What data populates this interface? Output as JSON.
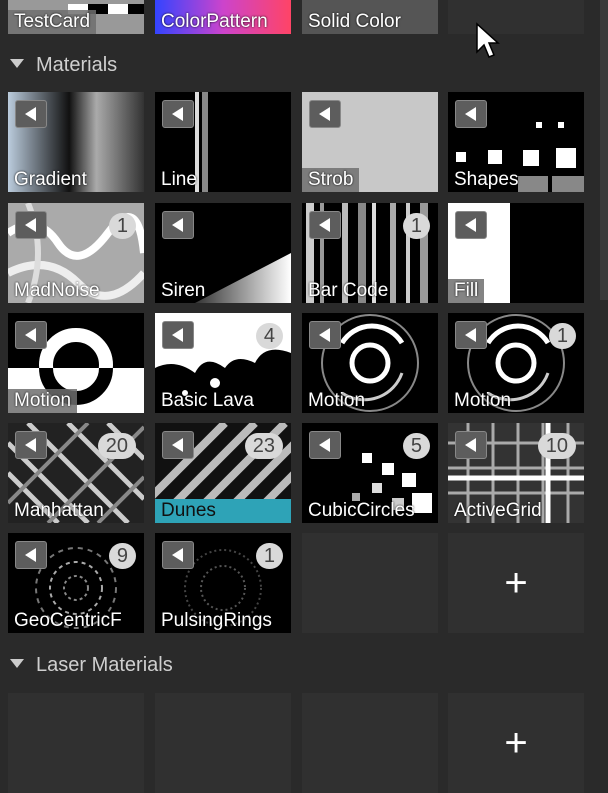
{
  "top_row": [
    {
      "name": "TestCard"
    },
    {
      "name": "ColorPattern"
    },
    {
      "name": "Solid Color"
    }
  ],
  "sections": {
    "materials": "Materials",
    "laser_materials": "Laser Materials"
  },
  "materials": [
    {
      "name": "Gradient",
      "badge": null
    },
    {
      "name": "Line",
      "badge": null
    },
    {
      "name": "Strob",
      "badge": null
    },
    {
      "name": "Shapes",
      "badge": null
    },
    {
      "name": "MadNoise",
      "badge": "1"
    },
    {
      "name": "Siren",
      "badge": null
    },
    {
      "name": "Bar Code",
      "badge": "1"
    },
    {
      "name": "Fill",
      "badge": null
    },
    {
      "name": "Motion",
      "badge": null
    },
    {
      "name": "Basic Lava",
      "badge": "4"
    },
    {
      "name": "Motion",
      "badge": null
    },
    {
      "name": "Motion",
      "badge": "1"
    },
    {
      "name": "Manhattan",
      "badge": "20"
    },
    {
      "name": "Dunes",
      "badge": "23",
      "selected": true
    },
    {
      "name": "CubicCircles",
      "badge": "5"
    },
    {
      "name": "ActiveGrid",
      "badge": "10"
    },
    {
      "name": "GeoCentricF",
      "badge": "9"
    },
    {
      "name": "PulsingRings",
      "badge": "1"
    }
  ],
  "add_label": "+",
  "icons": {
    "play": "play-left-icon",
    "collapse": "triangle-down-icon",
    "add": "plus-icon",
    "cursor": "mouse-cursor-icon"
  },
  "colors": {
    "selected": "#2ea3b7",
    "panel_bg": "#2a2a2a"
  }
}
